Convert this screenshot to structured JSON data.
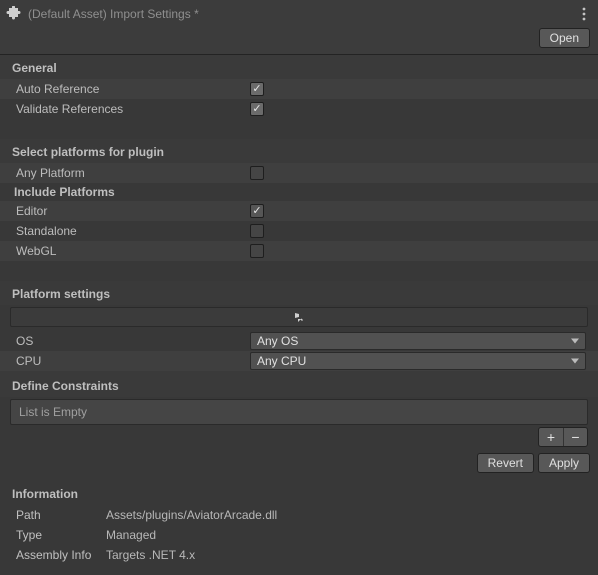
{
  "header": {
    "title": "(Default Asset) Import Settings *",
    "open_label": "Open"
  },
  "general": {
    "header": "General",
    "auto_reference_label": "Auto Reference",
    "auto_reference_checked": true,
    "validate_references_label": "Validate References",
    "validate_references_checked": true
  },
  "select_platforms": {
    "header": "Select platforms for plugin",
    "any_platform_label": "Any Platform",
    "any_platform_checked": false,
    "include_header": "Include Platforms",
    "rows": [
      {
        "label": "Editor",
        "checked": true
      },
      {
        "label": "Standalone",
        "checked": false
      },
      {
        "label": "WebGL",
        "checked": false
      }
    ]
  },
  "platform_settings": {
    "header": "Platform settings",
    "os_label": "OS",
    "os_value": "Any OS",
    "cpu_label": "CPU",
    "cpu_value": "Any CPU"
  },
  "define_constraints": {
    "header": "Define Constraints",
    "empty_text": "List is Empty",
    "add_label": "+",
    "remove_label": "−"
  },
  "footer": {
    "revert_label": "Revert",
    "apply_label": "Apply"
  },
  "information": {
    "header": "Information",
    "path_label": "Path",
    "path_value": "Assets/plugins/AviatorArcade.dll",
    "type_label": "Type",
    "type_value": "Managed",
    "assembly_info_label": "Assembly Info",
    "assembly_info_value": "Targets .NET 4.x"
  }
}
